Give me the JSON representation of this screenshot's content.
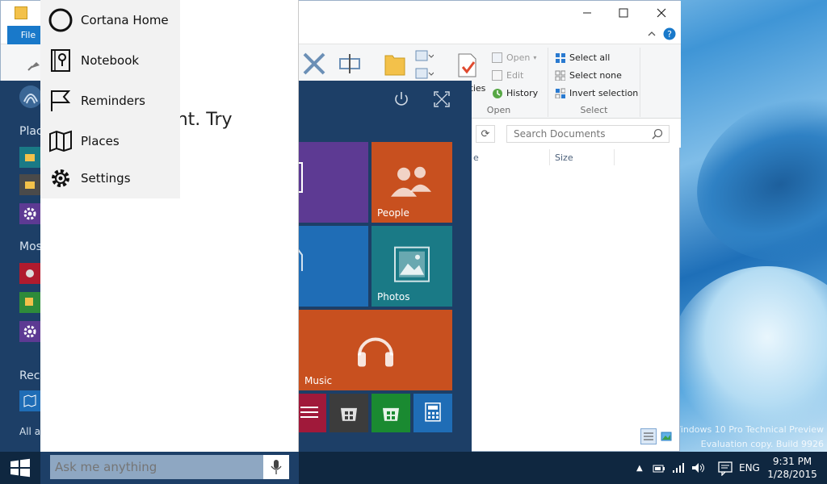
{
  "desktop": {
    "watermark_line1": "Windows 10 Pro Technical Preview",
    "watermark_line2": "Evaluation copy. Build 9926"
  },
  "explorer": {
    "file_tab": "File",
    "ribbon": {
      "properties_label": "rties",
      "open_label": "Open",
      "edit_label": "Edit",
      "history_label": "History",
      "group_open": "Open",
      "select_all": "Select all",
      "select_none": "Select none",
      "invert_selection": "Invert selection",
      "group_select": "Select"
    },
    "search_placeholder": "Search Documents",
    "columns": [
      "e",
      "Size"
    ]
  },
  "startmenu": {
    "sections": [
      "Plac",
      "Mos",
      "Rece"
    ],
    "all_apps": "All ap",
    "tiles": [
      {
        "label": "People",
        "color": "#c8501f"
      },
      {
        "label": "Photos",
        "color": "#1a7a86"
      },
      {
        "label": "Music",
        "color": "#c8501f"
      }
    ]
  },
  "cortana": {
    "message": "t right. Try bit.",
    "menu": [
      {
        "label": "Cortana Home",
        "icon": "circle-icon"
      },
      {
        "label": "Notebook",
        "icon": "notebook-icon"
      },
      {
        "label": "Reminders",
        "icon": "flag-icon"
      },
      {
        "label": "Places",
        "icon": "map-icon"
      },
      {
        "label": "Settings",
        "icon": "gear-icon"
      }
    ],
    "ask_placeholder": "Ask me anything"
  },
  "taskbar": {
    "language": "ENG",
    "time": "9:31 PM",
    "date": "1/28/2015"
  },
  "colors": {
    "start_bg": "#1d3f67",
    "taskbar_bg": "#0f2740",
    "accent": "#1979ca",
    "purple_tile": "#5d3a93",
    "blue_tile": "#1f6db6"
  }
}
